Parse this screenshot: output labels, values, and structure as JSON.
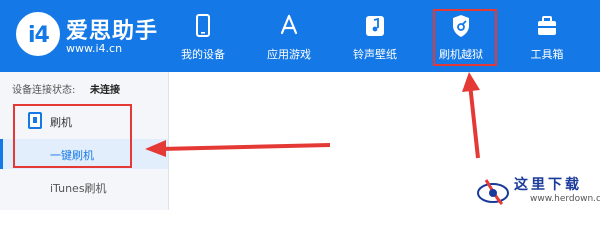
{
  "brand": {
    "name": "爱思助手",
    "url": "www.i4.cn",
    "logo_text": "i4"
  },
  "nav": [
    {
      "label": "我的设备",
      "icon": "phone-icon"
    },
    {
      "label": "应用游戏",
      "icon": "app-store-icon"
    },
    {
      "label": "铃声壁纸",
      "icon": "music-file-icon"
    },
    {
      "label": "刷机越狱",
      "icon": "shield-key-icon"
    },
    {
      "label": "工具箱",
      "icon": "toolbox-icon"
    }
  ],
  "status": {
    "label": "设备连接状态:",
    "value": "未连接"
  },
  "sidebar": {
    "section_label": "刷机",
    "active_item": "一键刷机",
    "items": [
      "iTunes刷机"
    ]
  },
  "watermark": {
    "text": "这里下载",
    "url": "www.herdown.com"
  },
  "colors": {
    "primary": "#1478e6",
    "annotation_red": "#e53935",
    "sidebar_bg": "#f4f6f9",
    "active_bg": "#e3eefc"
  }
}
